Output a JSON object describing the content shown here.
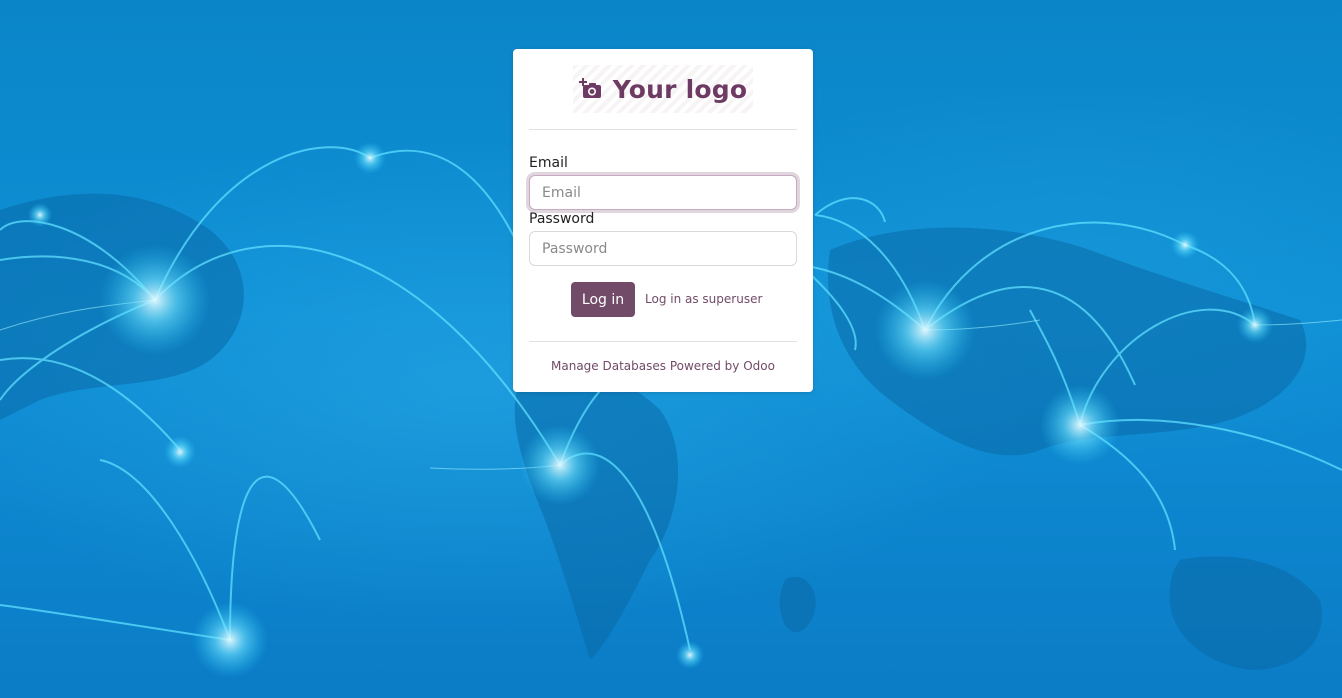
{
  "login": {
    "logo_text": "Your logo",
    "email_label": "Email",
    "email_placeholder": "Email",
    "email_value": "",
    "password_label": "Password",
    "password_placeholder": "Password",
    "password_value": "",
    "login_button": "Log in",
    "superuser_link": "Log in as superuser"
  },
  "footer": {
    "manage_databases": "Manage Databases",
    "powered_by": "Powered by Odoo"
  },
  "colors": {
    "brand": "#714b67",
    "background": "#0b86c8"
  },
  "icons": {
    "logo": "add-camera-icon"
  }
}
